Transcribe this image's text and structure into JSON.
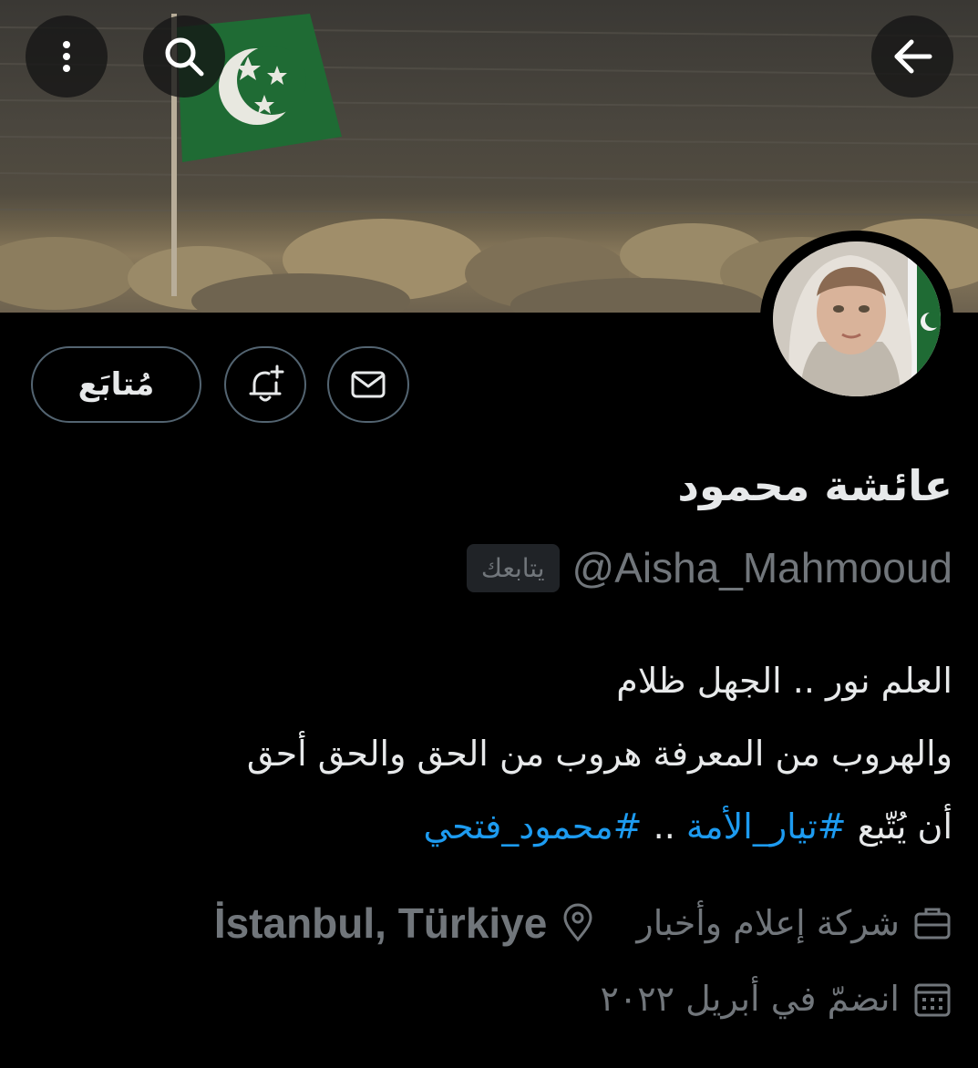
{
  "header": {
    "back_icon": "arrow-left-icon",
    "search_icon": "search-icon",
    "more_icon": "more-vertical-icon"
  },
  "actions": {
    "follow_label": "مُتابَع",
    "notify_icon": "bell-plus-icon",
    "message_icon": "mail-icon"
  },
  "profile": {
    "name": "عائشة محمود",
    "handle": "@Aisha_Mahmooud",
    "follows_you": "يتابعك",
    "bio_line1": "العلم نور .. الجهل ظلام",
    "bio_line2": "والهروب من المعرفة هروب من الحق والحق أحق",
    "bio_line3_prefix": "أن يُتّبع ",
    "bio_tag1": "#تيار_الأمة",
    "bio_sep": " .. ",
    "bio_tag2": "#محمود_فتحي",
    "category": "شركة إعلام وأخبار",
    "location": "İstanbul, Türkiye",
    "joined": "انضمّ في أبريل ٢٠٢٢"
  },
  "colors": {
    "background": "#000000",
    "text": "#e7e9ea",
    "secondary": "#71767b",
    "link": "#1d9bf0",
    "flag_green": "#1f6b34"
  }
}
